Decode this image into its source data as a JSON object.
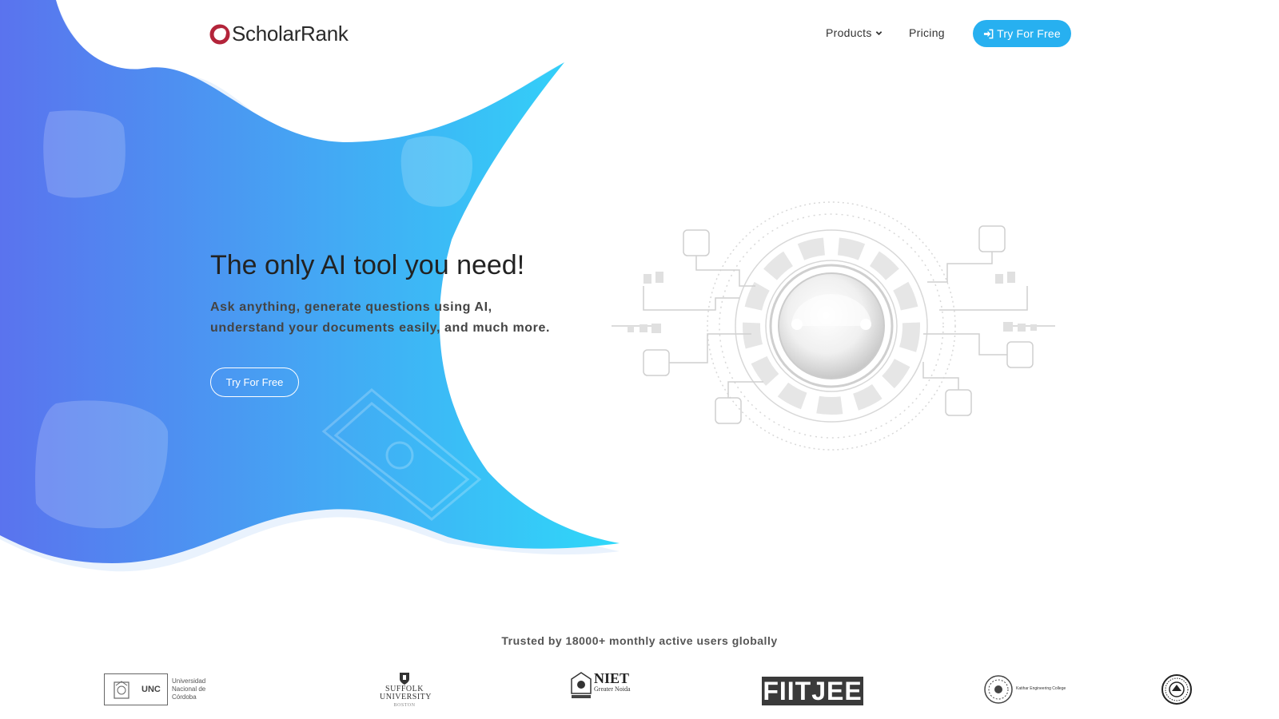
{
  "brand": {
    "name": "ScholarRank"
  },
  "nav": {
    "products_label": "Products",
    "pricing_label": "Pricing",
    "cta_label": "Try For Free"
  },
  "hero": {
    "headline": "The only AI tool you need!",
    "subtext_line1": "Ask anything, generate questions using AI,",
    "subtext_line2": "understand your documents easily, and much more.",
    "cta_label": "Try For Free"
  },
  "trusted": {
    "text": "Trusted by 18000+ monthly active users globally",
    "logos": [
      {
        "abbr": "UNC",
        "name": "Universidad Nacional de Córdoba"
      },
      {
        "name": "SUFFOLK UNIVERSITY",
        "sub": "BOSTON"
      },
      {
        "name": "NIET",
        "sub": "Greater Noida"
      },
      {
        "name": "FIITJEE"
      },
      {
        "name": "Katihar Engineering College"
      },
      {
        "name": "institution-seal"
      }
    ]
  },
  "colors": {
    "gradient_start": "#5a73ee",
    "gradient_end": "#2fd8f9",
    "accent": "#27b0f0",
    "logo_ring": "#b3243a"
  },
  "icons": [
    "logo-ring-icon",
    "chevron-down-icon",
    "sign-in-icon",
    "ai-circuit-illustration"
  ]
}
